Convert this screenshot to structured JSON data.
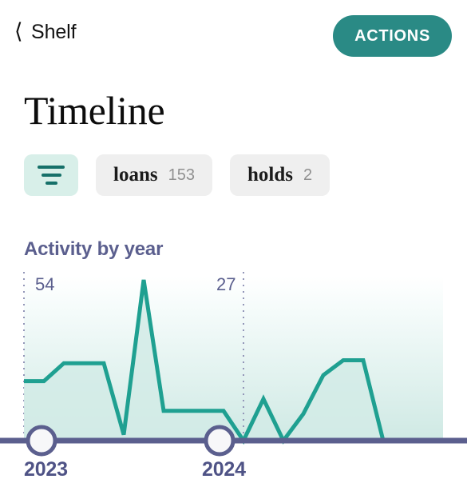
{
  "header": {
    "back_label": "Shelf",
    "back_icon": "chevron-left-icon",
    "actions_label": "ACTIONS",
    "accent_color": "#2a8a85"
  },
  "page_title": "Timeline",
  "filters": {
    "filter_icon": "filter-lines-icon",
    "chips": [
      {
        "label": "loans",
        "count": "153"
      },
      {
        "label": "holds",
        "count": "2"
      }
    ]
  },
  "chart_section": {
    "heading": "Activity by year"
  },
  "chart_data": {
    "type": "area",
    "title": "Activity by year",
    "xlabel": "",
    "ylabel": "",
    "line_color": "#1fa091",
    "area_fill_top": "#ffffff",
    "area_fill_bottom": "#d3ebe6",
    "axis_color": "#5b5f8e",
    "gridline_style": "dotted",
    "ylim": [
      0,
      54
    ],
    "groups": [
      {
        "name": "2023",
        "peak_label": "54",
        "axis_tick": "2023",
        "values": [
          20,
          20,
          26,
          26,
          26,
          2,
          54,
          10,
          10,
          10,
          10
        ]
      },
      {
        "name": "2024",
        "peak_label": "27",
        "axis_tick": "2024",
        "values": [
          0,
          14,
          0,
          9,
          22,
          27,
          27,
          0,
          0,
          0,
          0
        ]
      }
    ],
    "tick_labels": [
      "54",
      "27"
    ],
    "category_labels": [
      "2023",
      "2024"
    ],
    "markers": [
      {
        "label": "2023",
        "x": 52
      },
      {
        "label": "2024",
        "x": 275
      }
    ]
  }
}
